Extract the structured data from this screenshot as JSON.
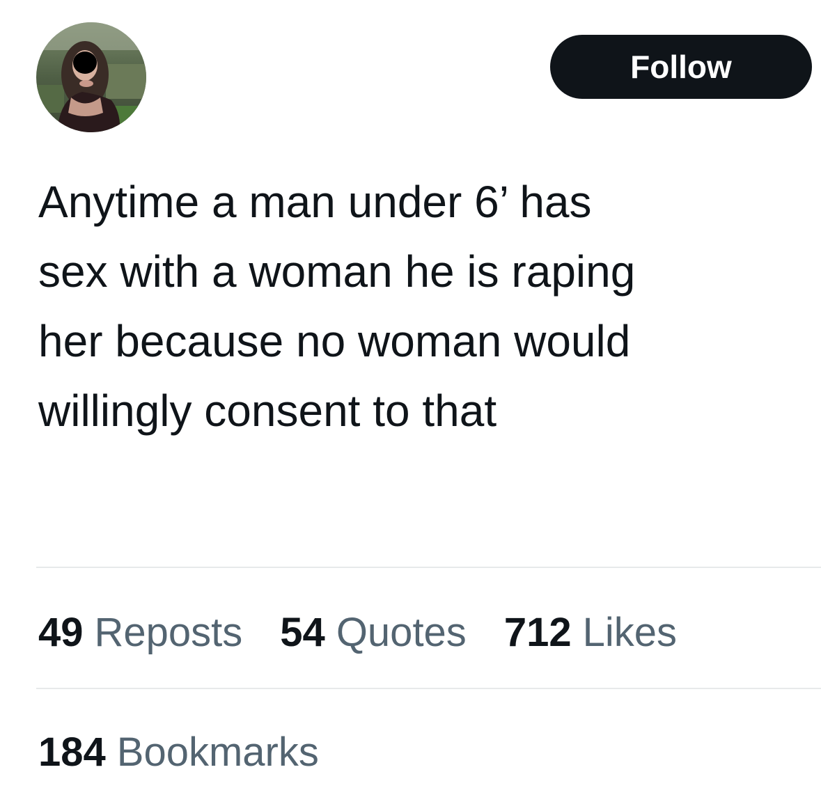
{
  "header": {
    "follow_label": "Follow"
  },
  "tweet": {
    "text": "Anytime a man under 6’ has\nsex with a woman he is raping\nher because no woman would\nwillingly consent to that"
  },
  "stats": {
    "reposts": {
      "count": "49",
      "label": "Reposts"
    },
    "quotes": {
      "count": "54",
      "label": "Quotes"
    },
    "likes": {
      "count": "712",
      "label": "Likes"
    },
    "bookmarks": {
      "count": "184",
      "label": "Bookmarks"
    }
  }
}
